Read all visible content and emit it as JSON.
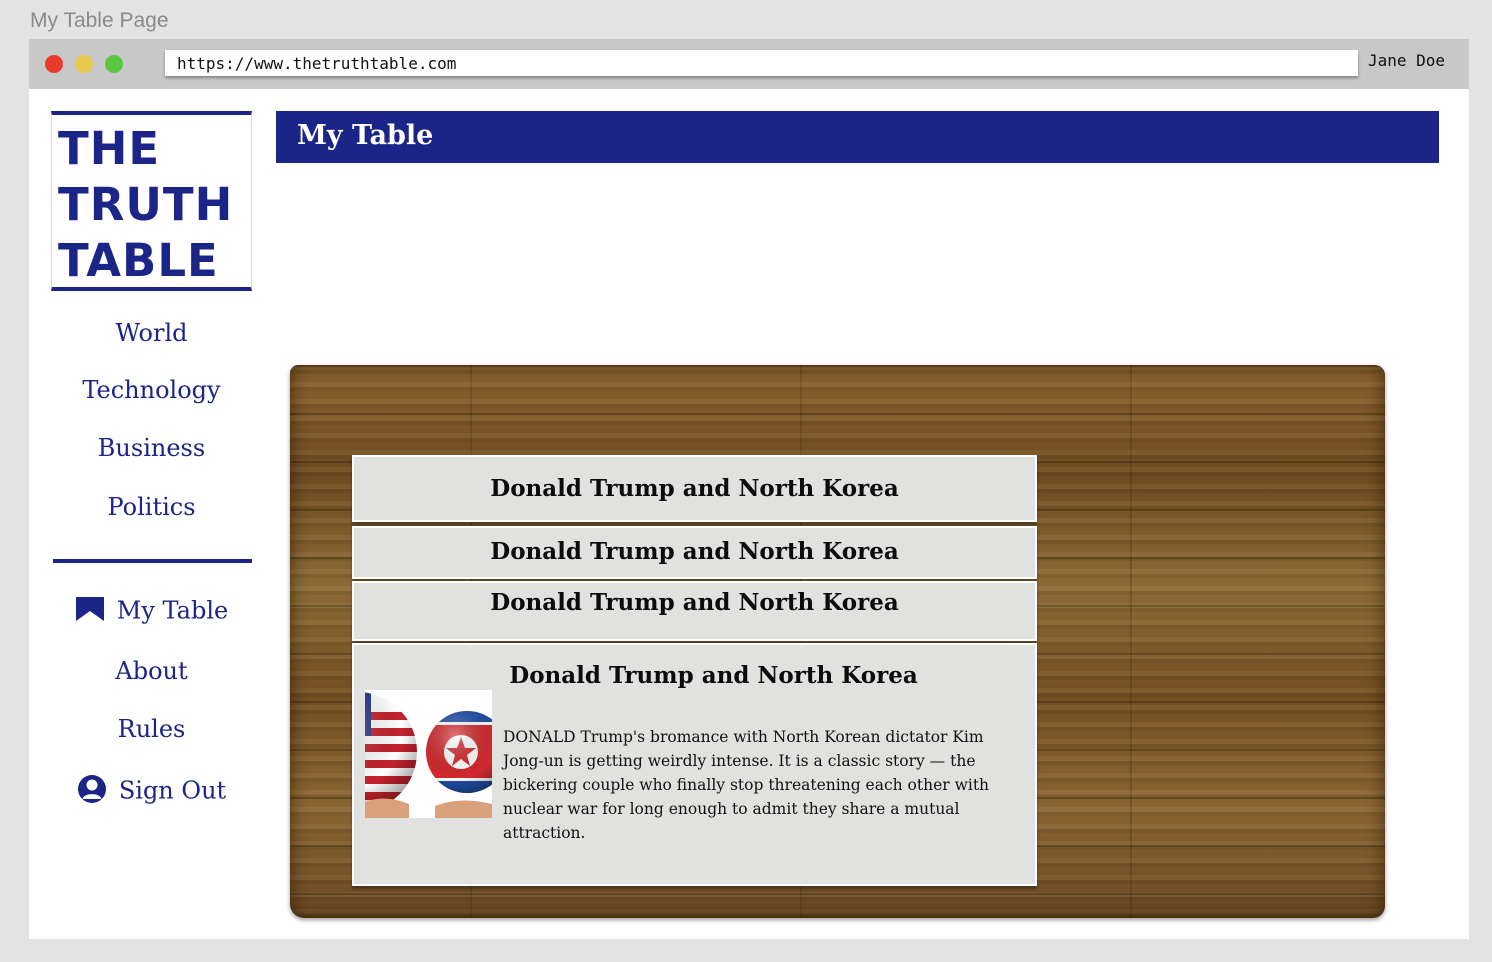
{
  "page_caption": "My Table Page",
  "browser": {
    "url": "https://www.thetruthtable.com",
    "user_name": "Jane Doe",
    "traffic_lights": {
      "close": "#ea3a2e",
      "minimize": "#e9c84e",
      "maximize": "#5cc840"
    }
  },
  "logo": {
    "lines": [
      "THE",
      "TRUTH",
      "TABLE"
    ],
    "color": "#1b2487"
  },
  "sidebar": {
    "sections": [
      "World",
      "Technology",
      "Business",
      "Politics"
    ],
    "account": {
      "my_table": "My Table",
      "about": "About",
      "rules": "Rules",
      "sign_out": "Sign Out"
    }
  },
  "header": {
    "title": "My Table",
    "background": "#1b2487"
  },
  "cards": [
    {
      "title": "Donald Trump and North Korea"
    },
    {
      "title": "Donald Trump and North Korea"
    },
    {
      "title": "Donald Trump and North Korea"
    },
    {
      "title": "Donald Trump and North Korea",
      "body": "DONALD Trump's bromance with North Korean dictator Kim Jong-un is getting weirdly intense. It is a classic story — the bickering couple who finally stop threatening each other with nuclear war for long enough to admit they share a mutual attraction.",
      "image": "us-and-north-korea-flag-spheres"
    }
  ]
}
